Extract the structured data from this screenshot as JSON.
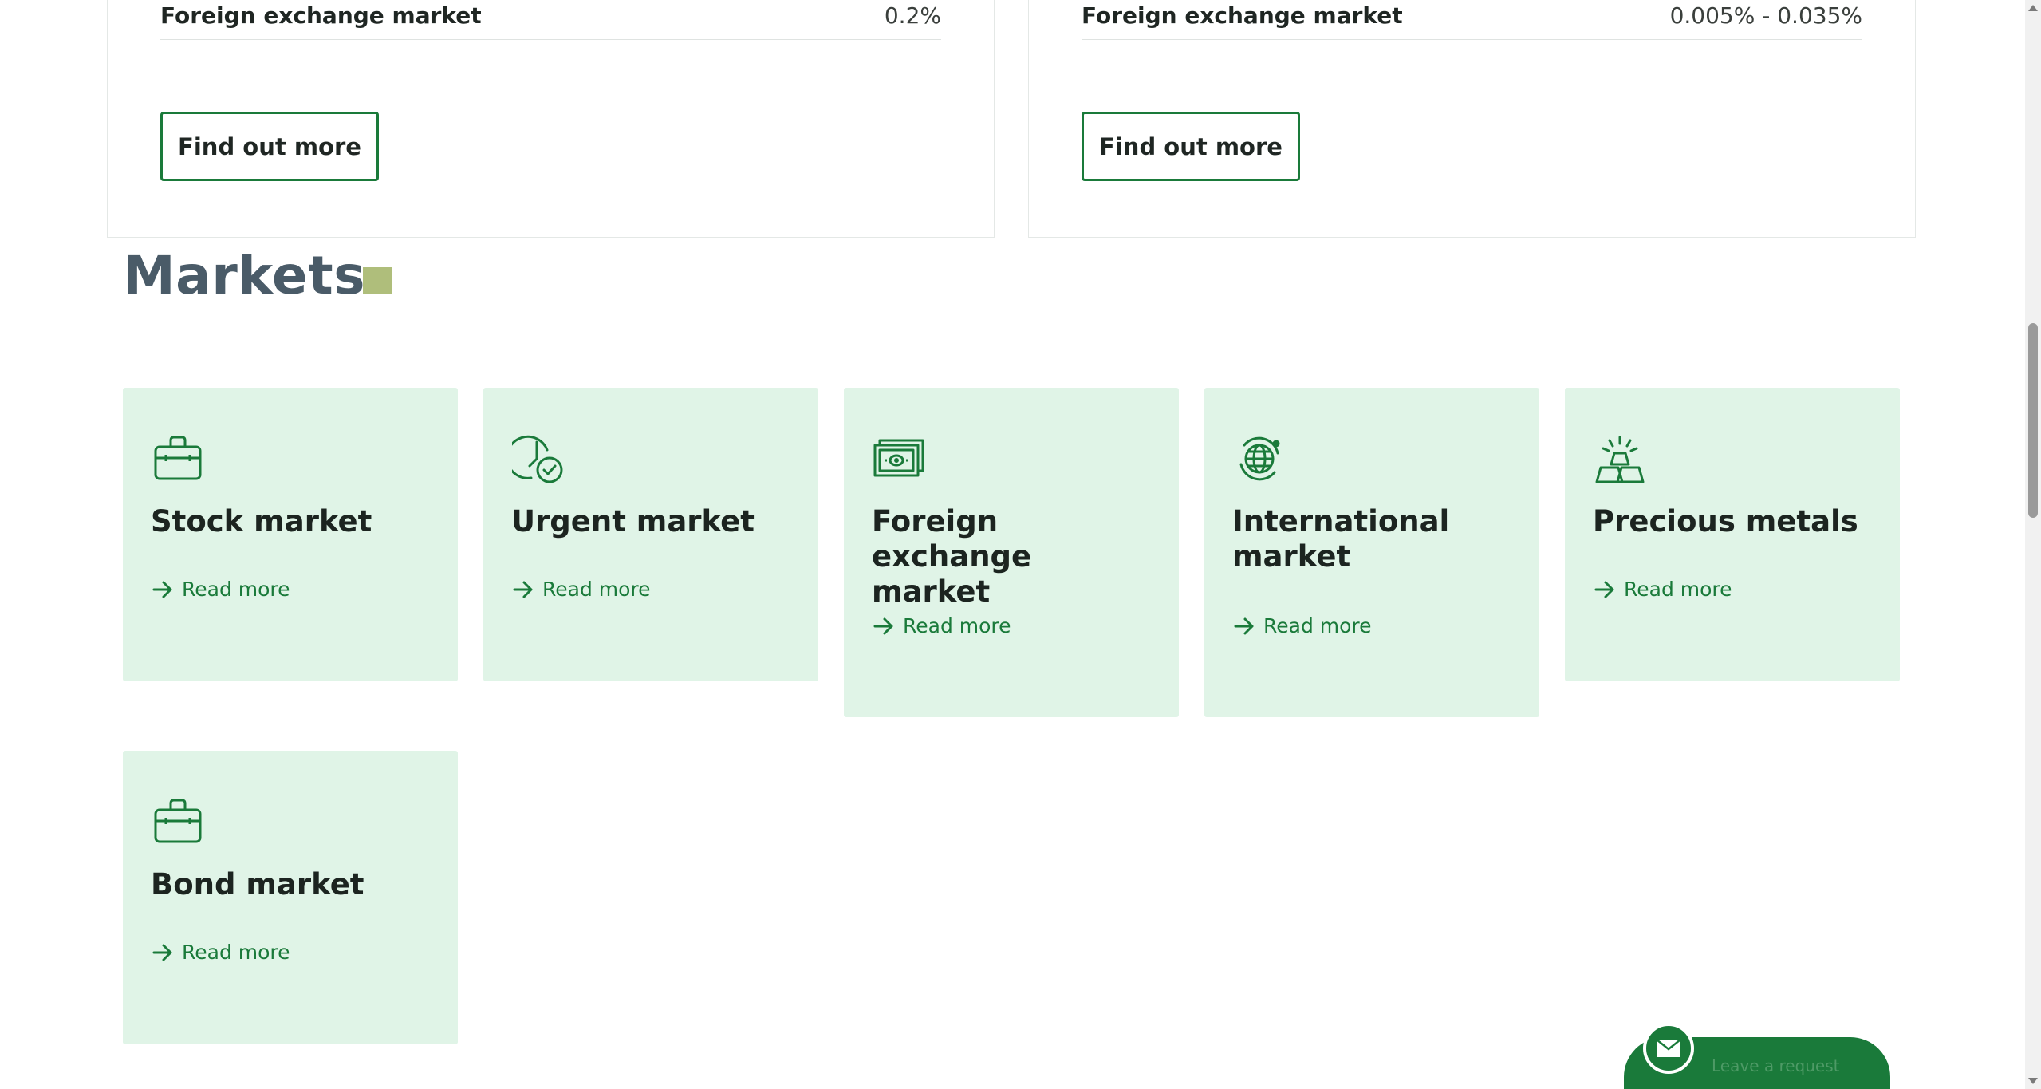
{
  "tariffs": [
    {
      "name": "Foreign exchange market",
      "value": "0.2%",
      "button": "Find out more"
    },
    {
      "name": "Foreign exchange market",
      "value": "0.005% - 0.035%",
      "button": "Find out more"
    }
  ],
  "markets": {
    "title": "Markets",
    "accent_color": "#afbe7b",
    "tiles": [
      {
        "title": "Stock market",
        "icon": "briefcase-icon",
        "link": "Read more"
      },
      {
        "title": "Urgent market",
        "icon": "clock-check-icon",
        "link": "Read more"
      },
      {
        "title": "Foreign exchange market",
        "icon": "banknotes-icon",
        "link": "Read more"
      },
      {
        "title": "International market",
        "icon": "globe-icon",
        "link": "Read more"
      },
      {
        "title": "Precious metals",
        "icon": "gold-bars-icon",
        "link": "Read more"
      },
      {
        "title": "Bond market",
        "icon": "briefcase-icon",
        "link": "Read more"
      }
    ]
  },
  "request_widget": {
    "label": "Leave a request",
    "icon": "mail-icon"
  },
  "colors": {
    "brand_green": "#1a7a3a",
    "tile_bg": "#e0f4e7",
    "heading": "#4a5b68"
  }
}
